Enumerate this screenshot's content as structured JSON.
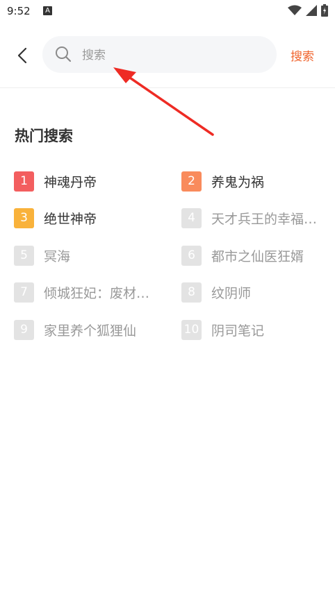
{
  "status_bar": {
    "time": "9:52",
    "notification_glyph": "A",
    "icons": [
      "wifi-icon",
      "signal-icon",
      "battery-icon"
    ]
  },
  "header": {
    "back_icon": "chevron-left-icon",
    "search_placeholder": "搜索",
    "search_value": "",
    "search_button_label": "搜索"
  },
  "hot_search": {
    "title": "热门搜索",
    "items": [
      {
        "rank": "1",
        "title": "神魂丹帝"
      },
      {
        "rank": "2",
        "title": "养鬼为祸"
      },
      {
        "rank": "3",
        "title": "绝世神帝"
      },
      {
        "rank": "4",
        "title": "天才兵王的幸福生活"
      },
      {
        "rank": "5",
        "title": "冥海"
      },
      {
        "rank": "6",
        "title": "都市之仙医狂婿"
      },
      {
        "rank": "7",
        "title": "倾城狂妃：废材逆天"
      },
      {
        "rank": "8",
        "title": "纹阴师"
      },
      {
        "rank": "9",
        "title": "家里养个狐狸仙"
      },
      {
        "rank": "10",
        "title": "阴司笔记"
      }
    ]
  },
  "colors": {
    "accent": "#f0642e",
    "rank1": "#f35e5f",
    "rank2": "#f98b5c",
    "rank3": "#f9b23b",
    "rank_default": "#e3e3e3",
    "annotation_arrow": "#ee2b24"
  }
}
